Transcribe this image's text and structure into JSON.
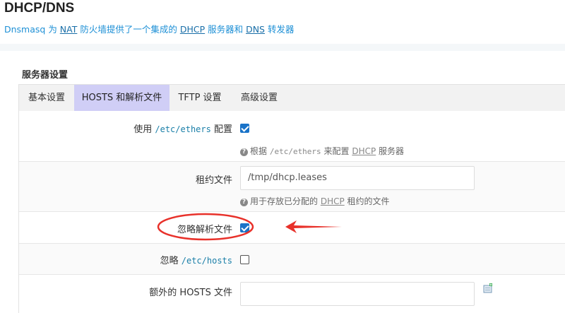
{
  "page": {
    "title": "DHCP/DNS",
    "desc": {
      "p1": "Dnsmasq 为 ",
      "nat": "NAT",
      "p2": " 防火墙提供了一个集成的 ",
      "dhcp": "DHCP",
      "p3": " 服务器和 ",
      "dns": "DNS",
      "p4": " 转发器"
    }
  },
  "section": {
    "title": "服务器设置"
  },
  "tabs": [
    {
      "label": "基本设置",
      "active": false
    },
    {
      "label": "HOSTS 和解析文件",
      "active": true
    },
    {
      "label": "TFTP 设置",
      "active": false
    },
    {
      "label": "高级设置",
      "active": false
    }
  ],
  "fields": {
    "use_ethers": {
      "label_pre": "使用 ",
      "label_code": "/etc/ethers",
      "label_post": " 配置",
      "checked": true,
      "help_pre": "根据 ",
      "help_code": "/etc/ethers",
      "help_mid": " 来配置 ",
      "help_link": "DHCP",
      "help_post": " 服务器"
    },
    "lease_file": {
      "label": "租约文件",
      "value": "/tmp/dhcp.leases",
      "help_pre": "用于存放已分配的 ",
      "help_link": "DHCP",
      "help_post": " 租约的文件"
    },
    "ignore_resolv": {
      "label": "忽略解析文件",
      "checked": true
    },
    "ignore_hosts": {
      "label_pre": "忽略 ",
      "label_code": "/etc/hosts",
      "checked": false
    },
    "extra_hosts": {
      "label": "额外的 HOSTS 文件",
      "value": "",
      "add_icon": "add-file-icon"
    }
  },
  "colors": {
    "accent": "#1a73c8",
    "active_tab": "#d0cef6",
    "annotation_red": "#e8312a"
  }
}
